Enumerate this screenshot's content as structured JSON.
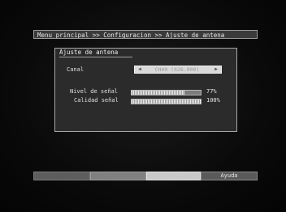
{
  "breadcrumb": "Menu principal >> Configuracion >> Ajuste de antena",
  "panel": {
    "title": "Ajuste de antena",
    "channel_label": "Canal",
    "channel_value": "CH40 (626.000)",
    "signal_level_label": "Nivel de señal",
    "signal_level_value": "77%",
    "signal_level_fraction": 0.77,
    "signal_quality_label": "Calidad señal",
    "signal_quality_value": "100%",
    "signal_quality_fraction": 1.0
  },
  "footer": {
    "help_label": "Ayuda"
  }
}
